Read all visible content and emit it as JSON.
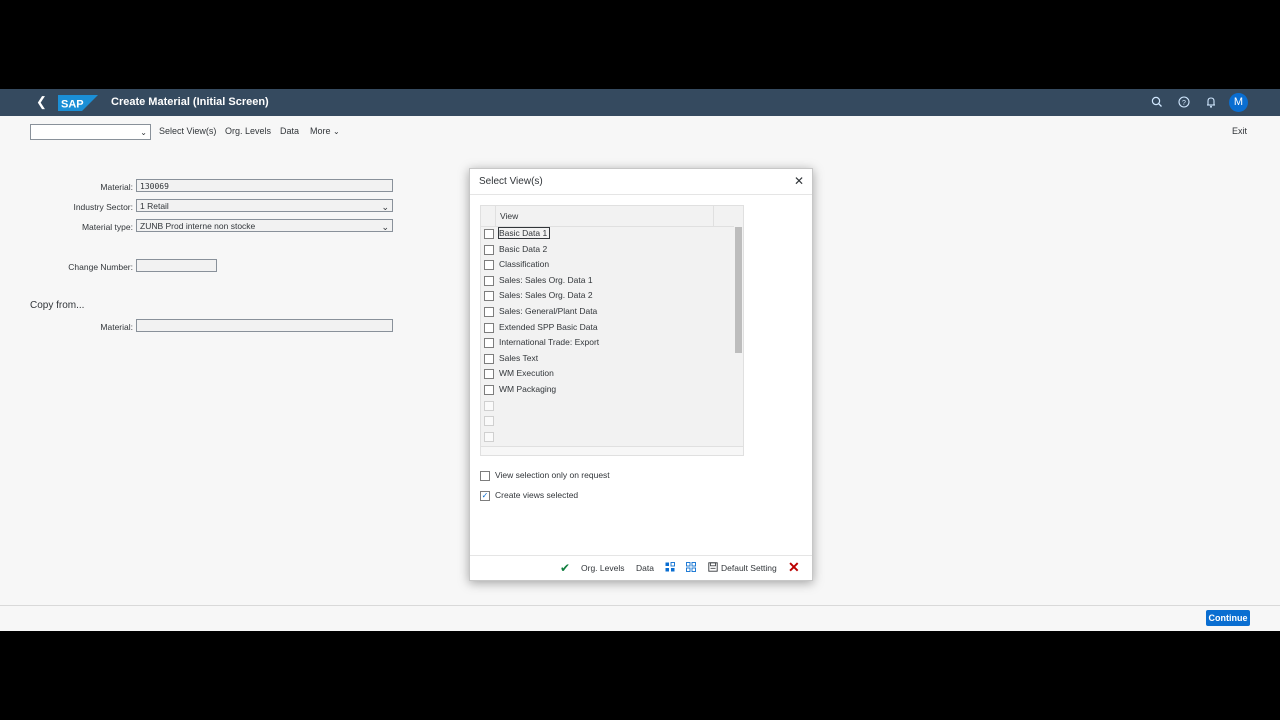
{
  "shell": {
    "title": "Create Material (Initial Screen)",
    "logo_text": "SAP",
    "avatar_initial": "M"
  },
  "toolbar": {
    "select_views": "Select View(s)",
    "org_levels": "Org. Levels",
    "data": "Data",
    "more": "More",
    "exit": "Exit"
  },
  "form": {
    "material_label": "Material:",
    "material_value": "130069",
    "industry_label": "Industry Sector:",
    "industry_value": "1 Retail",
    "type_label": "Material type:",
    "type_value": "ZUNB Prod interne non stocke",
    "change_label": "Change Number:",
    "change_value": "",
    "copy_from": "Copy from...",
    "copy_material_label": "Material:",
    "copy_material_value": ""
  },
  "dialog": {
    "title": "Select View(s)",
    "column_header": "View",
    "views": [
      "Basic Data 1",
      "Basic Data 2",
      "Classification",
      "Sales: Sales Org. Data 1",
      "Sales: Sales Org. Data 2",
      "Sales: General/Plant Data",
      "Extended SPP Basic Data",
      "International Trade: Export",
      "Sales Text",
      "WM Execution",
      "WM Packaging"
    ],
    "opt_on_request": "View selection only on request",
    "opt_on_request_checked": false,
    "opt_create_selected": "Create views selected",
    "opt_create_selected_checked": true,
    "footer": {
      "org_levels": "Org. Levels",
      "data": "Data",
      "default_setting": "Default Setting"
    }
  },
  "footer": {
    "continue": "Continue"
  },
  "colors": {
    "shell": "#354a5f",
    "accent": "#0a6ed1",
    "ok": "#107e3e",
    "cancel": "#bb0000"
  }
}
